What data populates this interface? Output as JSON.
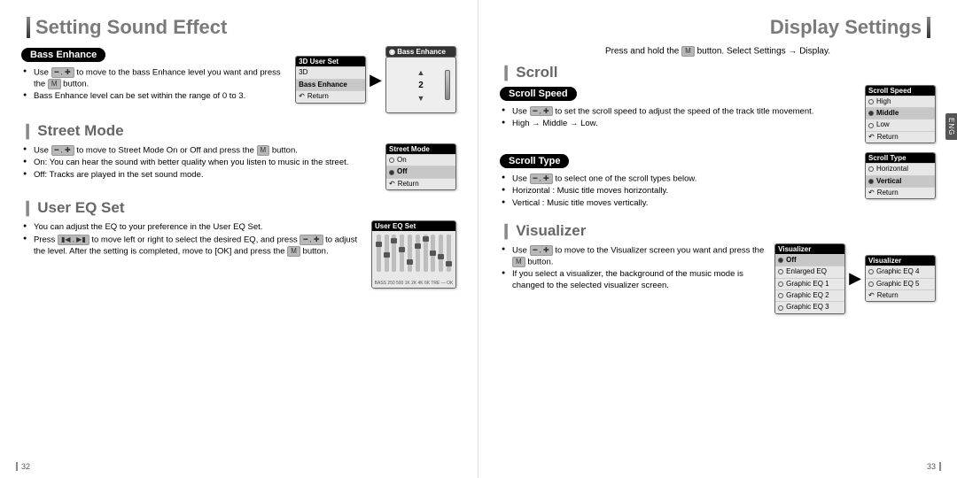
{
  "left": {
    "title": "Setting Sound Effect",
    "bass_enhance": {
      "pill": "Bass Enhance",
      "b1_a": "Use ",
      "b1_b": " to move to the bass Enhance level you want and press the ",
      "b1_c": " button.",
      "b2": "Bass Enhance level can be set within the range of 0 to 3.",
      "screen1": {
        "title": "3D User Set",
        "items": [
          "3D",
          "Bass Enhance"
        ],
        "return": "Return"
      },
      "screen2": {
        "title": "Bass Enhance",
        "value": "2"
      }
    },
    "street_mode": {
      "title": "Street Mode",
      "b1_a": "Use ",
      "b1_b": " to move to Street Mode On or Off and press the ",
      "b1_c": " button.",
      "b2": "On: You can hear the sound with better quality when you listen to music in the street.",
      "b3": "Off: Tracks are played in the set sound mode.",
      "screen": {
        "title": "Street Mode",
        "on": "On",
        "off": "Off",
        "return": "Return"
      }
    },
    "user_eq": {
      "title": "User EQ Set",
      "b1": "You can adjust the EQ to your preference in the User EQ Set.",
      "b2_a": "Press ",
      "b2_b": " to move left or right to select the desired EQ, and press ",
      "b2_c": " to adjust the level. After the setting is completed, move to [OK] and press the ",
      "b2_d": " button.",
      "screen_title": "User EQ Set",
      "bands": [
        "BASS",
        "250",
        "500",
        "1K",
        "2K",
        "4K",
        "6K",
        "TRE",
        "—",
        "OK"
      ],
      "positions": [
        8,
        20,
        4,
        14,
        28,
        10,
        2,
        18,
        22,
        30
      ]
    },
    "page": "32"
  },
  "right": {
    "title": "Display Settings",
    "intro_a": "Press and hold the ",
    "intro_b": " button. Select Settings → Display.",
    "scroll": {
      "title": "Scroll",
      "speed": {
        "pill": "Scroll Speed",
        "b1_a": "Use ",
        "b1_b": " to set the scroll speed to adjust the speed of the track title movement.",
        "b2": "High → Middle → Low.",
        "screen": {
          "title": "Scroll Speed",
          "items": [
            "High",
            "Middle",
            "Low"
          ],
          "sel": 1,
          "return": "Return"
        }
      },
      "type": {
        "pill": "Scroll Type",
        "b1_a": "Use ",
        "b1_b": " to select one of the scroll types below.",
        "b2": "Horizontal : Music title moves horizontally.",
        "b3": "Vertical : Music title moves vertically.",
        "screen": {
          "title": "Scroll Type",
          "items": [
            "Horizontal",
            "Vertical"
          ],
          "sel": 1,
          "return": "Return"
        }
      }
    },
    "visualizer": {
      "title": "Visualizer",
      "b1_a": "Use ",
      "b1_b": " to move to the Visualizer screen you want and press the ",
      "b1_c": " button.",
      "b2": "If you select a visualizer, the background of the music mode is changed to the selected visualizer screen.",
      "screen1": {
        "title": "Visualizer",
        "items": [
          "Off",
          "Enlarged EQ",
          "Graphic EQ 1",
          "Graphic EQ 2",
          "Graphic EQ 3"
        ],
        "sel": 0
      },
      "screen2": {
        "title": "Visualizer",
        "items": [
          "Graphic EQ 4",
          "Graphic EQ 5"
        ],
        "return": "Return"
      }
    },
    "eng": "ENG",
    "page": "33"
  },
  "icons": {
    "minus_plus": "━ , ✚",
    "m": "M",
    "prev_next": "▮◀ , ▶▮"
  }
}
